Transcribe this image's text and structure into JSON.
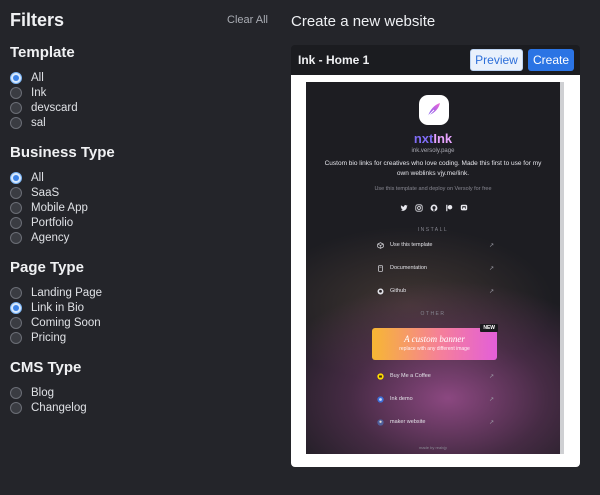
{
  "filters": {
    "title": "Filters",
    "clear_label": "Clear All",
    "groups": [
      {
        "title": "Template",
        "options": [
          {
            "label": "All",
            "checked": true
          },
          {
            "label": "Ink",
            "checked": false
          },
          {
            "label": "devscard",
            "checked": false
          },
          {
            "label": "sal",
            "checked": false
          }
        ]
      },
      {
        "title": "Business Type",
        "options": [
          {
            "label": "All",
            "checked": true
          },
          {
            "label": "SaaS",
            "checked": false
          },
          {
            "label": "Mobile App",
            "checked": false
          },
          {
            "label": "Portfolio",
            "checked": false
          },
          {
            "label": "Agency",
            "checked": false
          }
        ]
      },
      {
        "title": "Page Type",
        "options": [
          {
            "label": "Landing Page",
            "checked": false
          },
          {
            "label": "Link in Bio",
            "checked": true
          },
          {
            "label": "Coming Soon",
            "checked": false
          },
          {
            "label": "Pricing",
            "checked": false
          }
        ]
      },
      {
        "title": "CMS Type",
        "options": [
          {
            "label": "Blog",
            "checked": false
          },
          {
            "label": "Changelog",
            "checked": false
          }
        ]
      }
    ]
  },
  "create": {
    "title": "Create a new website",
    "template_name": "Ink - Home 1",
    "preview_label": "Preview",
    "create_label": "Create"
  },
  "site": {
    "brand_nxt": "nxt",
    "brand_ink": "Ink",
    "url": "ink.versoly.page",
    "description": "Custom bio links for creatives who love coding. Made this first to use for my own weblinks vjy.me/link.",
    "use_line": "Use this template and deploy on Versoly for free",
    "socials": [
      "twitter-icon",
      "instagram-icon",
      "github-icon",
      "patreon-icon",
      "mastodon-icon"
    ],
    "install_label": "INSTALL",
    "install_links": [
      {
        "icon": "cube-icon",
        "label": "Use this template"
      },
      {
        "icon": "book-icon",
        "label": "Documentation"
      },
      {
        "icon": "github-icon",
        "label": "Github"
      }
    ],
    "other_label": "OTHER",
    "banner": {
      "title": "A custom banner",
      "subtitle": "replace with any different image",
      "badge": "NEW"
    },
    "other_links": [
      {
        "icon": "coffee-icon",
        "label": "Buy Me a Coffee"
      },
      {
        "icon": "ink-avatar-icon",
        "label": "Ink demo"
      },
      {
        "icon": "maker-avatar-icon",
        "label": "maker website"
      }
    ],
    "arrow": "↗",
    "made_by": "made by realvjy"
  },
  "colors": {
    "background": "#24252a",
    "accent": "#2b74e4",
    "radio_checked": "#3b82e6"
  }
}
